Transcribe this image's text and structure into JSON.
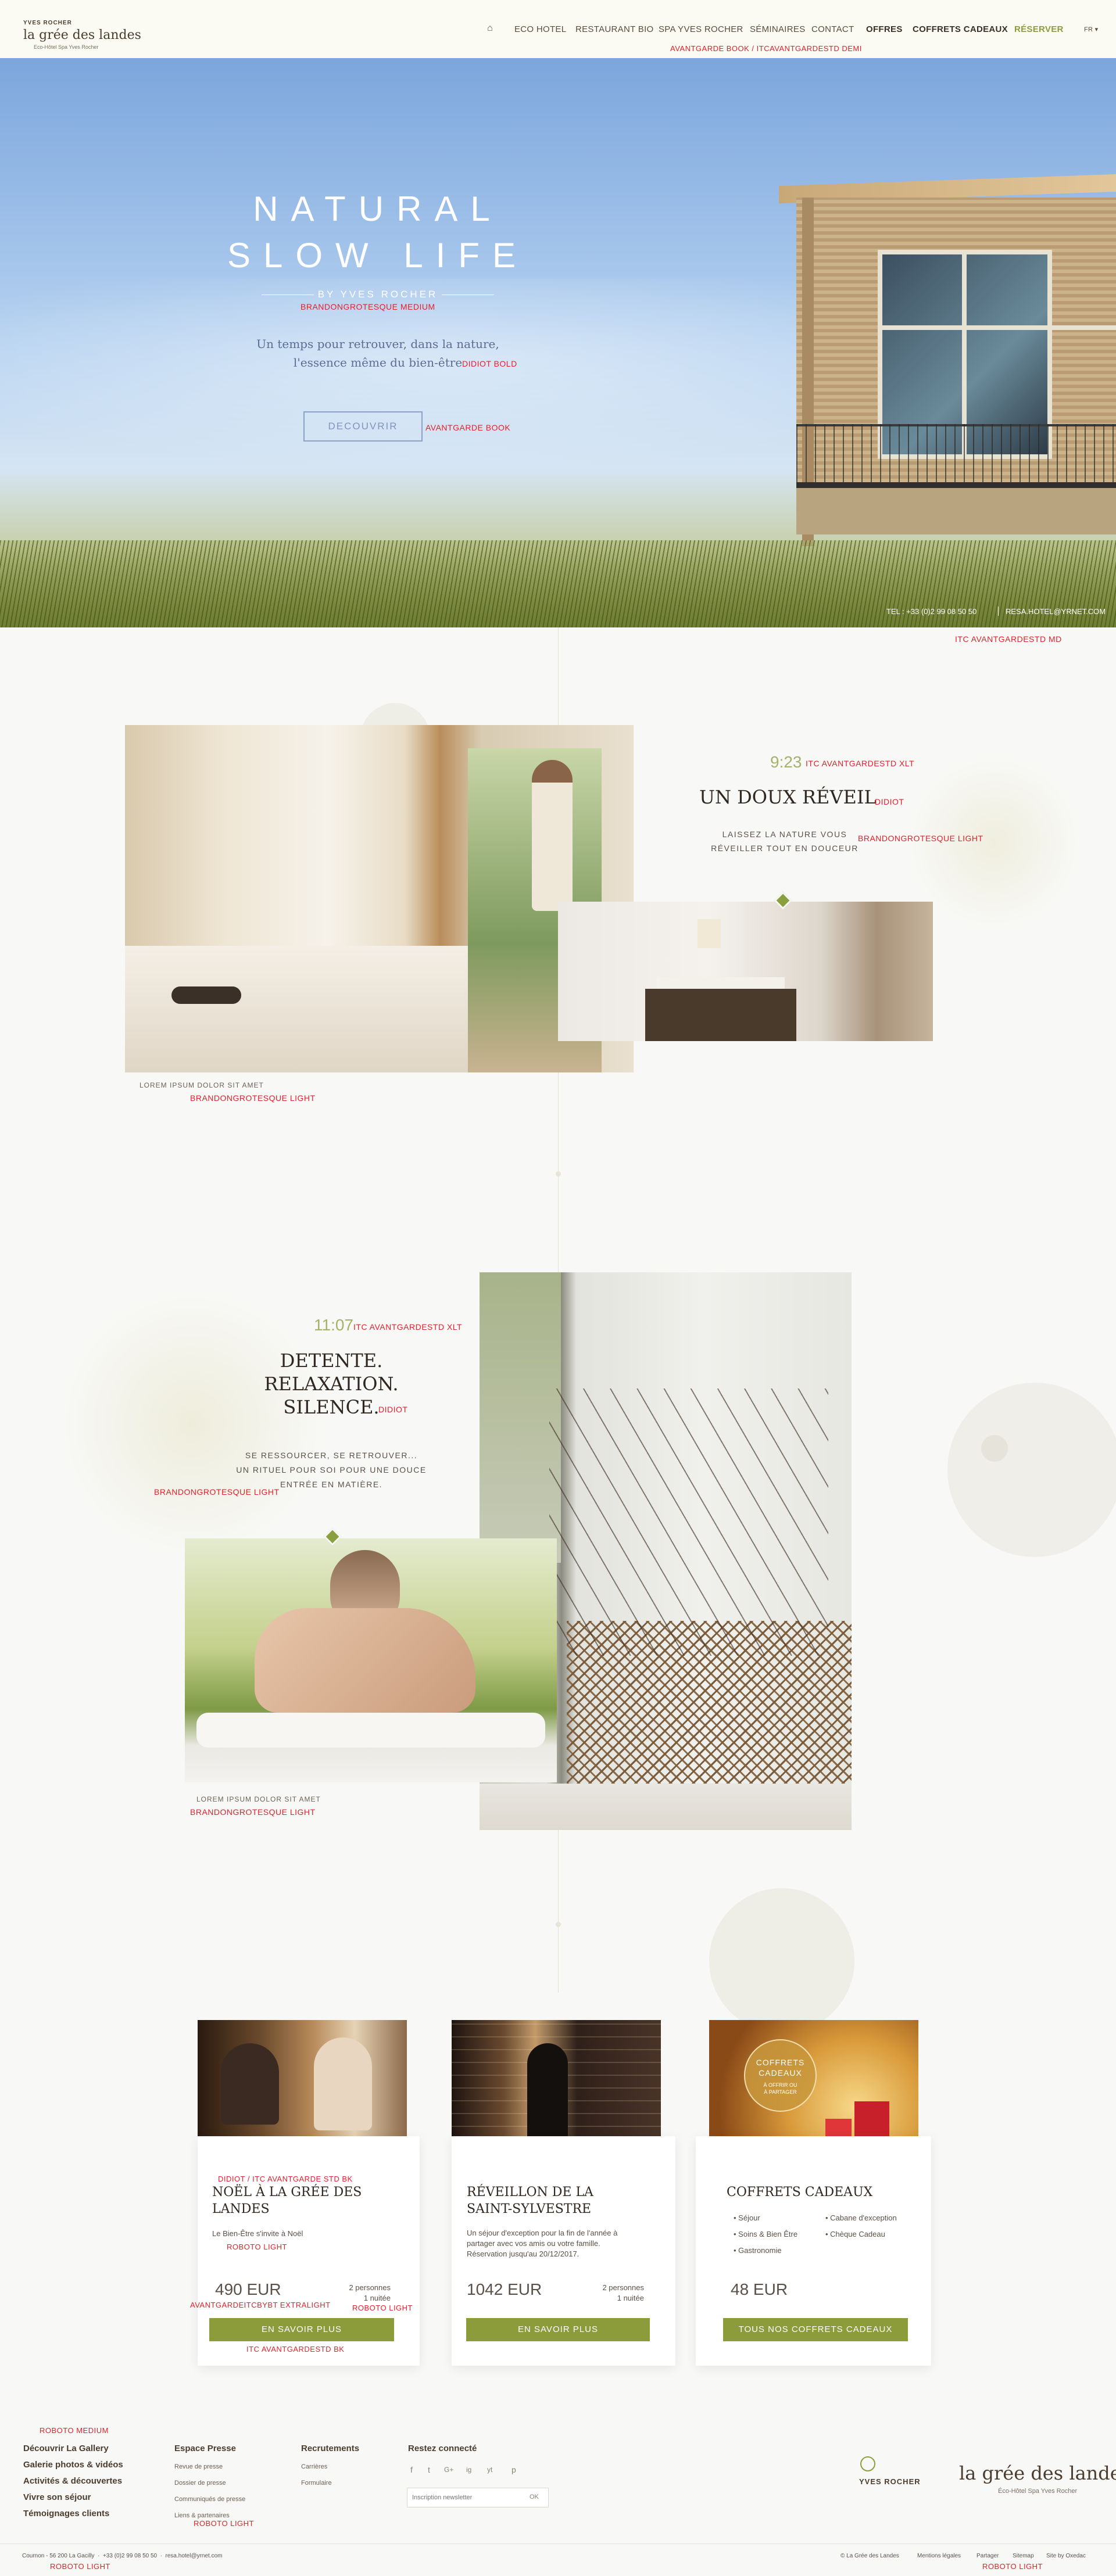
{
  "header": {
    "brand_top": "YVES ROCHER",
    "brand_name": "la grée des landes",
    "brand_sub": "Eco-Hôtel Spa Yves Rocher",
    "nav": [
      "ECO HOTEL",
      "RESTAURANT BIO",
      "SPA YVES ROCHER",
      "SÉMINAIRES",
      "CONTACT"
    ],
    "offres": "OFFRES",
    "coffrets": "COFFRETS CADEAUX",
    "reserver": "RÉSERVER",
    "lang": "FR ▾",
    "font_note": "AVANTGARDE BOOK / ITCAVANTGARDESTD DEMI"
  },
  "hero": {
    "title_line1": "NATURAL",
    "title_line2": "SLOW LIFE",
    "by_line": "BY YVES ROCHER",
    "by_font_note": "BRANDONGROTESQUE MEDIUM",
    "tagline_line1": "Un temps pour retrouver, dans la nature,",
    "tagline_line2": "l'essence même du bien-être",
    "tagline_font_note": "DIDIOT BOLD",
    "button": "DECOUVRIR",
    "button_font_note": "AVANTGARDE BOOK",
    "phone": "TEL : +33 (0)2 99 08 50 50",
    "email": "RESA.HOTEL@YRNET.COM",
    "contact_font_note": "ITC AVANTGARDESTD MD"
  },
  "section1": {
    "time": "9:23",
    "time_font_note": "ITC AVANTGARDESTD XLT",
    "title": "UN DOUX RÉVEIL",
    "title_font_note": "DIDIOT",
    "text_line1": "LAISSEZ LA NATURE VOUS",
    "text_line2": "RÉVEILLER TOUT EN DOUCEUR",
    "text_font_note": "BRANDONGROTESQUE LIGHT",
    "caption": "LOREM IPSUM DOLOR SIT AMET",
    "caption_font_note": "BRANDONGROTESQUE LIGHT"
  },
  "section2": {
    "time": "11:07",
    "time_font_note": "ITC AVANTGARDESTD XLT",
    "title_line1": "DETENTE.",
    "title_line2": "RELAXATION.",
    "title_line3": "SILENCE.",
    "title_font_note": "DIDIOT",
    "text_line1": "SE RESSOURCER, SE RETROUVER...",
    "text_line2": "UN RITUEL POUR SOI POUR UNE DOUCE",
    "text_line3": "ENTRÉE EN MATIÈRE.",
    "text_font_note": "BRANDONGROTESQUE LIGHT",
    "caption": "LOREM IPSUM DOLOR SIT AMET",
    "caption_font_note": "BRANDONGROTESQUE LIGHT"
  },
  "offers": [
    {
      "font_note_title": "DIDIOT / ITC AVANTGARDE STD BK",
      "title_line1": "NOËL À LA GRÉE DES",
      "title_line2": "LANDES",
      "desc": "Le Bien-Être s'invite à Noël",
      "desc_font_note": "ROBOTO LIGHT",
      "price": "490 EUR",
      "price_font_note": "AVANTGARDEITCBYBT EXTRALIGHT",
      "persons": "2 personnes",
      "nights": "1 nuitée",
      "persons_font_note": "ROBOTO LIGHT",
      "button": "EN SAVOIR PLUS",
      "button_font_note": "ITC AVANTGARDESTD BK"
    },
    {
      "title_line1": "RÉVEILLON DE LA",
      "title_line2": "SAINT-SYLVESTRE",
      "desc_line1": "Un séjour d'exception pour la fin de l'année à",
      "desc_line2": "partager avec vos amis ou votre famille.",
      "desc_line3": "Réservation jusqu'au 20/12/2017.",
      "price": "1042 EUR",
      "persons": "2 personnes",
      "nights": "1 nuitée",
      "button": "EN SAVOIR PLUS"
    },
    {
      "badge_line1": "COFFRETS",
      "badge_line2": "CADEAUX",
      "badge_line3": "À OFFRIR OU",
      "badge_line4": "À PARTAGER",
      "title": "COFFRETS CADEAUX",
      "items_left": [
        "• Séjour",
        "• Soins & Bien Être",
        "• Gastronomie"
      ],
      "items_right": [
        "• Cabane d'exception",
        "• Chèque Cadeau"
      ],
      "price": "48 EUR",
      "button": "TOUS NOS COFFRETS CADEAUX"
    }
  ],
  "footer": {
    "font_note_top": "ROBOTO MEDIUM",
    "col1": [
      "Découvrir La Gallery",
      "Galerie photos & vidéos",
      "Activités & découvertes",
      "Vivre son séjour",
      "Témoignages clients"
    ],
    "col2_title": "Espace Presse",
    "col2": [
      "Revue de presse",
      "Dossier de presse",
      "Communiqués de presse",
      "Liens & partenaires"
    ],
    "col2_font_note": "ROBOTO LIGHT",
    "col3_title": "Recrutements",
    "col3": [
      "Carrières",
      "Formulaire"
    ],
    "col4_title": "Restez connecté",
    "social": [
      "f",
      "t",
      "G+",
      "ig",
      "yt",
      "p"
    ],
    "newsletter_placeholder": "Inscription newsletter",
    "newsletter_ok": "OK",
    "logo_yr": "YVES ROCHER",
    "logo_name": "la grée des landes",
    "logo_sub": "Éco-Hôtel Spa Yves Rocher",
    "bottom_left": "Cournon - 56 200 La Gacilly  ·  +33 (0)2 99 08 50 50  ·  resa.hotel@yrnet.com",
    "bottom_left_font_note": "ROBOTO LIGHT",
    "bottom_right": [
      "© La Grée des Landes",
      "Mentions légales",
      "Partager",
      "Sitemap",
      "Site by Oxedac"
    ],
    "bottom_right_font_note": "ROBOTO LIGHT"
  },
  "colors": {
    "accent_green": "#8c9c3b",
    "annotation_red": "#e3202a",
    "text_brown": "#4a4338",
    "background": "#f8f8f6"
  }
}
